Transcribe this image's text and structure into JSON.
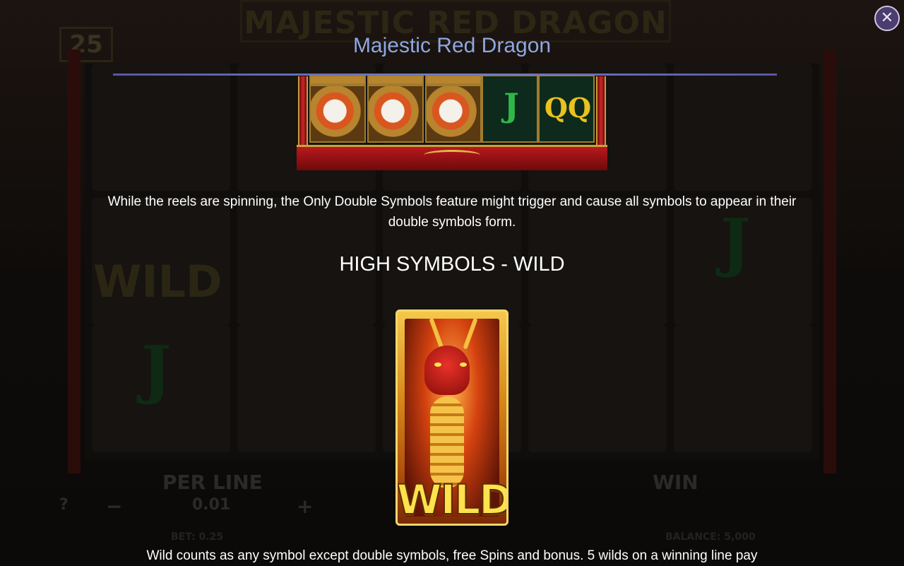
{
  "background": {
    "game_title": "MAJESTIC RED DRAGON",
    "lines_count": "25",
    "wild_label": "WILD",
    "per_line_label": "PER LINE",
    "per_line_value": "0.01",
    "win_label": "WIN",
    "bet_text": "BET: 0.25",
    "balance_text": "BALANCE: 5,000",
    "minus": "−",
    "plus": "+",
    "help": "?"
  },
  "paytable": {
    "title": "Majestic Red Dragon",
    "close_label": "✕",
    "preview_symbols": [
      "J",
      "QQ"
    ],
    "feature_description": "While the reels are spinning, the Only Double Symbols feature might trigger and cause all symbols to appear in their double symbols form.",
    "section_heading": "HIGH SYMBOLS - WILD",
    "wild_card_text": "WILD",
    "wild_description": "Wild counts as any symbol except double symbols, free Spins and bonus. 5 wilds on a winning line pay"
  },
  "colors": {
    "title": "#8ea7e0",
    "rule": "#6c7dd0",
    "wild_gold": "#ffe14d"
  }
}
